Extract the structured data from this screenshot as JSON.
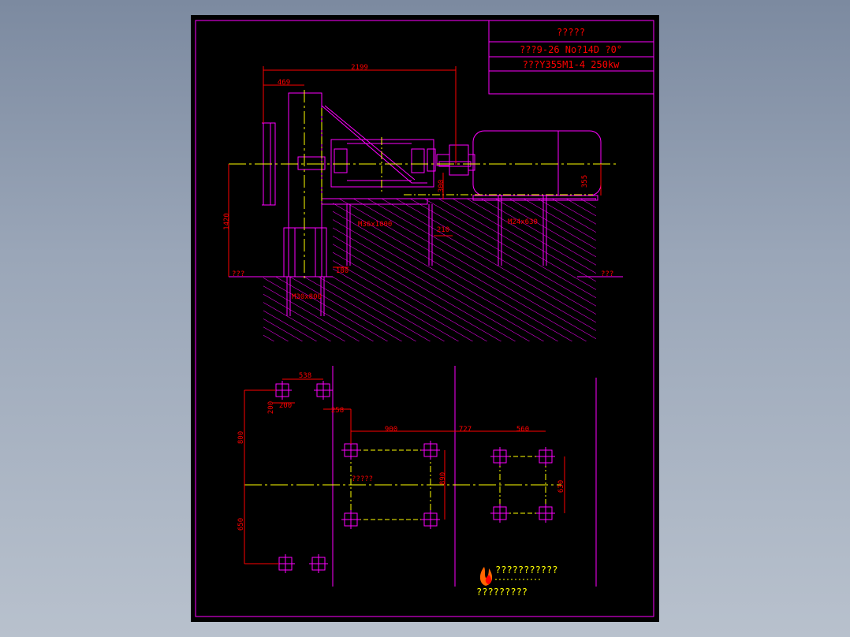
{
  "title_block": {
    "title": "?????",
    "line1": "???9-26 No?14D ?0°",
    "line2": "???Y355M1-4 250kw"
  },
  "dimensions": {
    "d2199": "2199",
    "d469": "469",
    "d1420": "1420",
    "d300": "300",
    "d355": "355",
    "d210": "210",
    "d180": "180",
    "d538": "538",
    "d200a": "200",
    "d200b": "200",
    "d258": "258",
    "d800": "800",
    "d650": "650",
    "d900": "900",
    "d727": "727",
    "d560": "560",
    "d890": "890",
    "d630": "630"
  },
  "bolts": {
    "m36": "M36x1000",
    "m24": "M24x630",
    "m30": "M30x800"
  },
  "labels": {
    "ground_left": "???",
    "ground_right": "???",
    "axis_label": "?????",
    "logo_text": "???????????",
    "company": "?????????"
  },
  "colors": {
    "line": "#ff00ff",
    "centerline": "#ffff00",
    "dimension": "#ff0000",
    "paper": "#000000"
  }
}
